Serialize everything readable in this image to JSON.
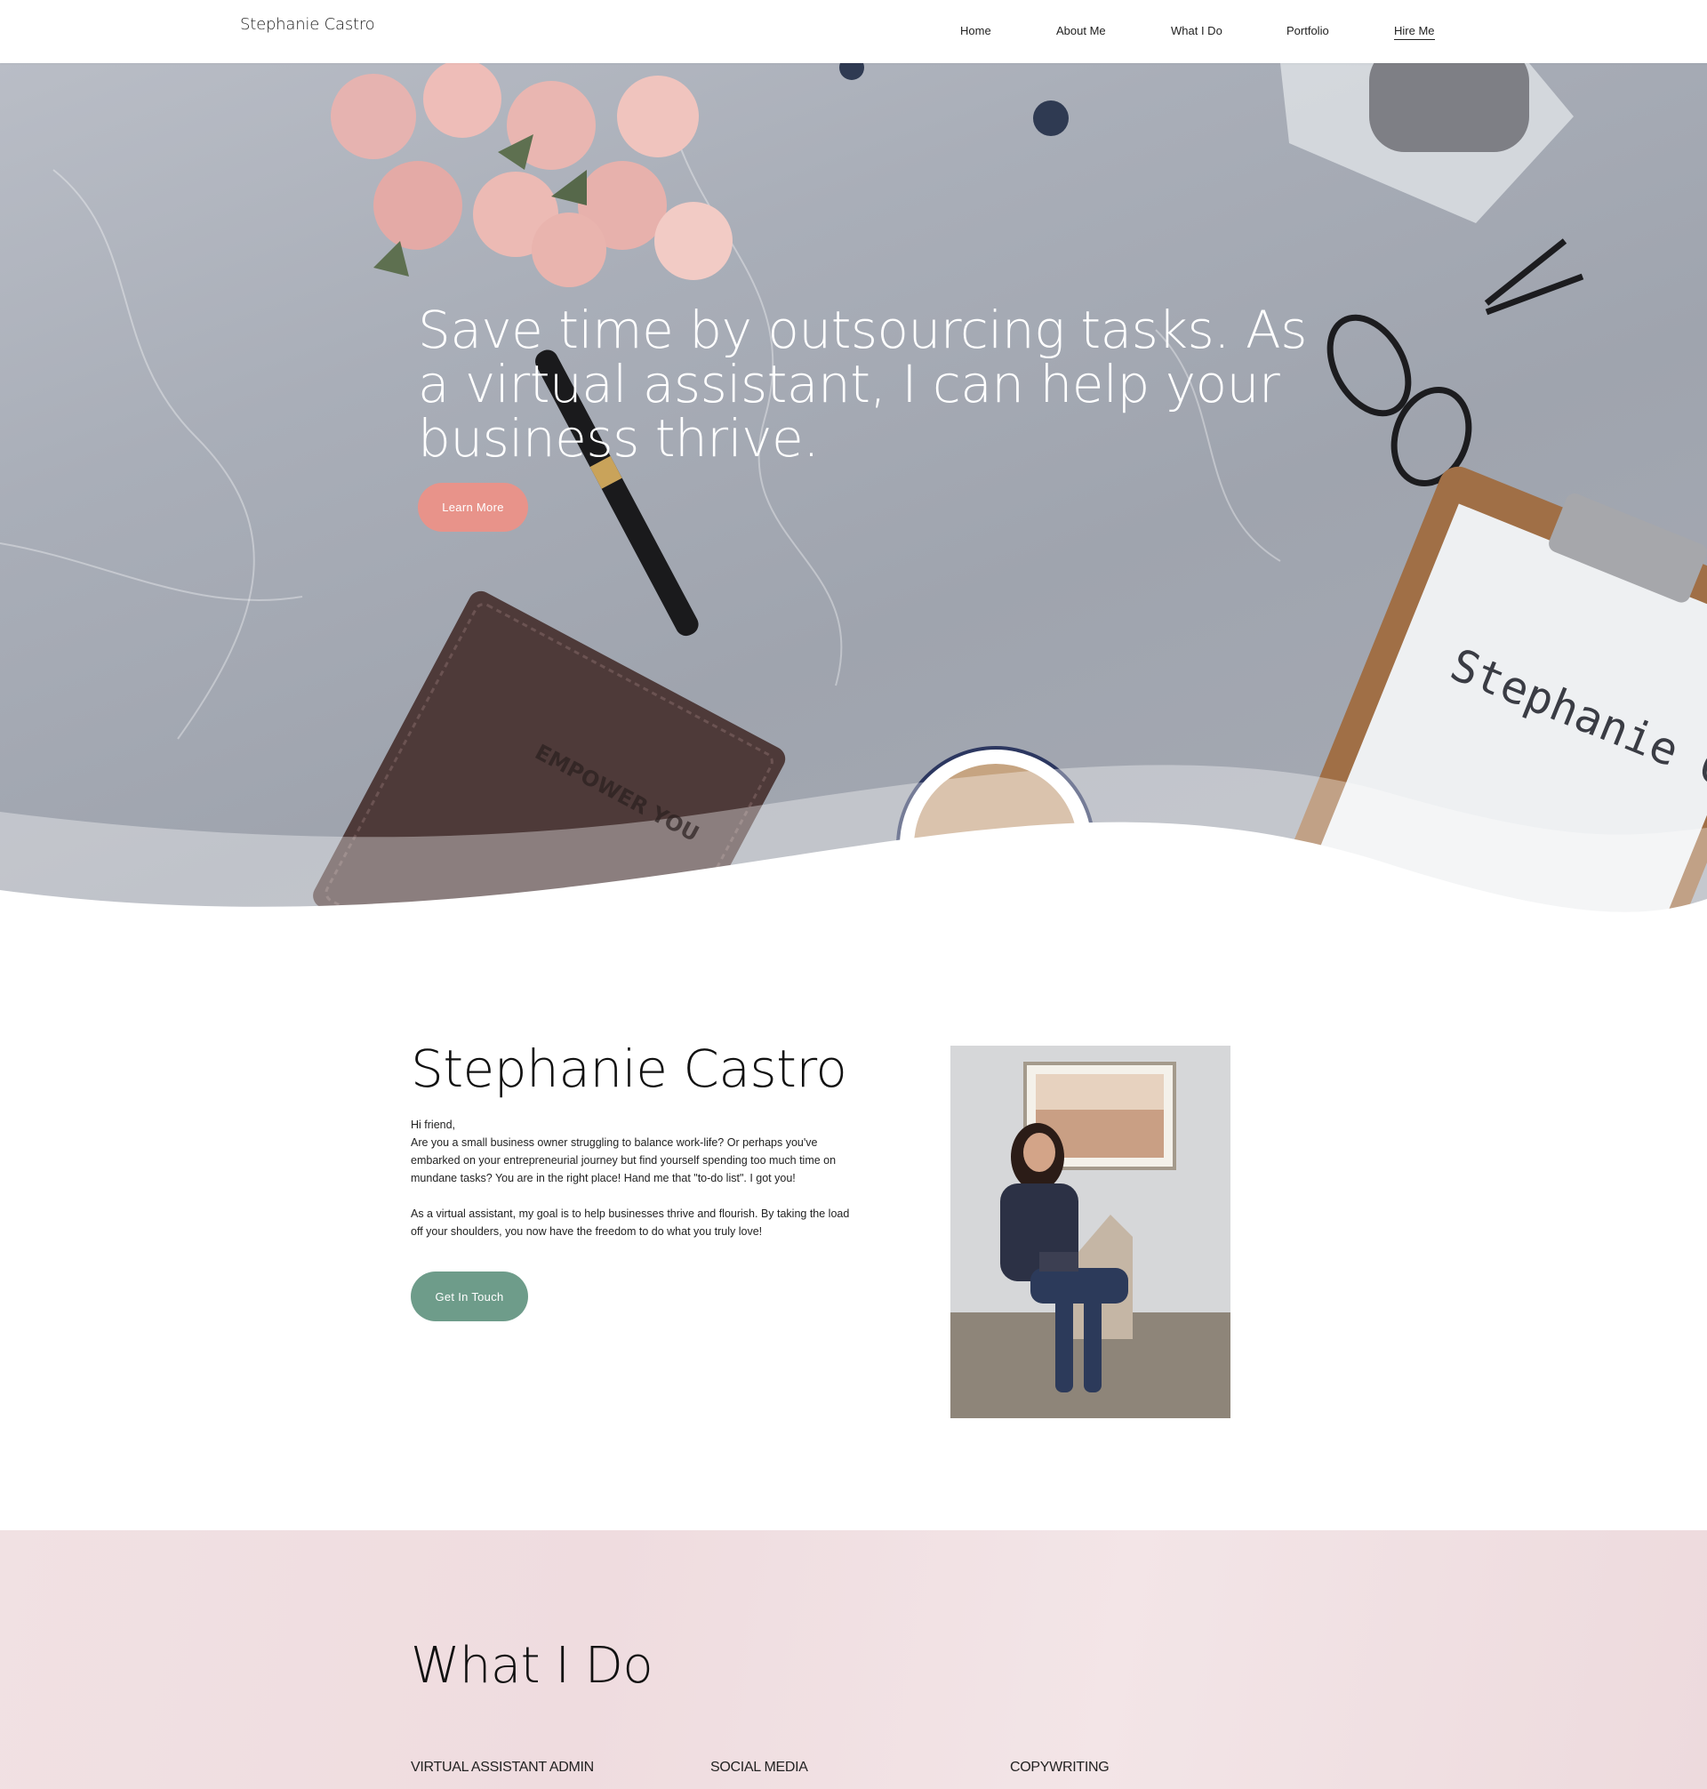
{
  "header": {
    "brand": "Stephanie Castro",
    "nav": [
      {
        "label": "Home"
      },
      {
        "label": "About Me"
      },
      {
        "label": "What I Do"
      },
      {
        "label": "Portfolio"
      },
      {
        "label": "Hire Me",
        "active": true
      }
    ]
  },
  "hero": {
    "headline": "Save time by outsourcing tasks. As a virtual assistant, I can help your business thrive.",
    "cta_label": "Learn More",
    "decor_text": {
      "notebook": "EMPOWER YOU",
      "clipboard": "Stephanie Castro"
    }
  },
  "about": {
    "title": "Stephanie Castro",
    "greeting": "Hi friend,",
    "paragraph1": "Are you a small business owner struggling to balance work-life? Or perhaps you've embarked on your entrepreneurial journey but find yourself spending too much time on mundane tasks? You are in the right place! Hand me that \"to-do list\". I got you!",
    "paragraph2": "As a virtual assistant, my goal is to help businesses thrive and flourish. By taking the load off your shoulders, you now have the freedom to do what you truly love!",
    "cta_label": "Get In Touch"
  },
  "services": {
    "title": "What I Do",
    "columns": [
      {
        "label": "VIRTUAL ASSISTANT ADMIN"
      },
      {
        "label": "SOCIAL MEDIA"
      },
      {
        "label": "COPYWRITING"
      }
    ]
  },
  "colors": {
    "accent_pink": "#e8938a",
    "accent_green": "#6e9c8a",
    "section_pink": "#f1e1e3"
  }
}
